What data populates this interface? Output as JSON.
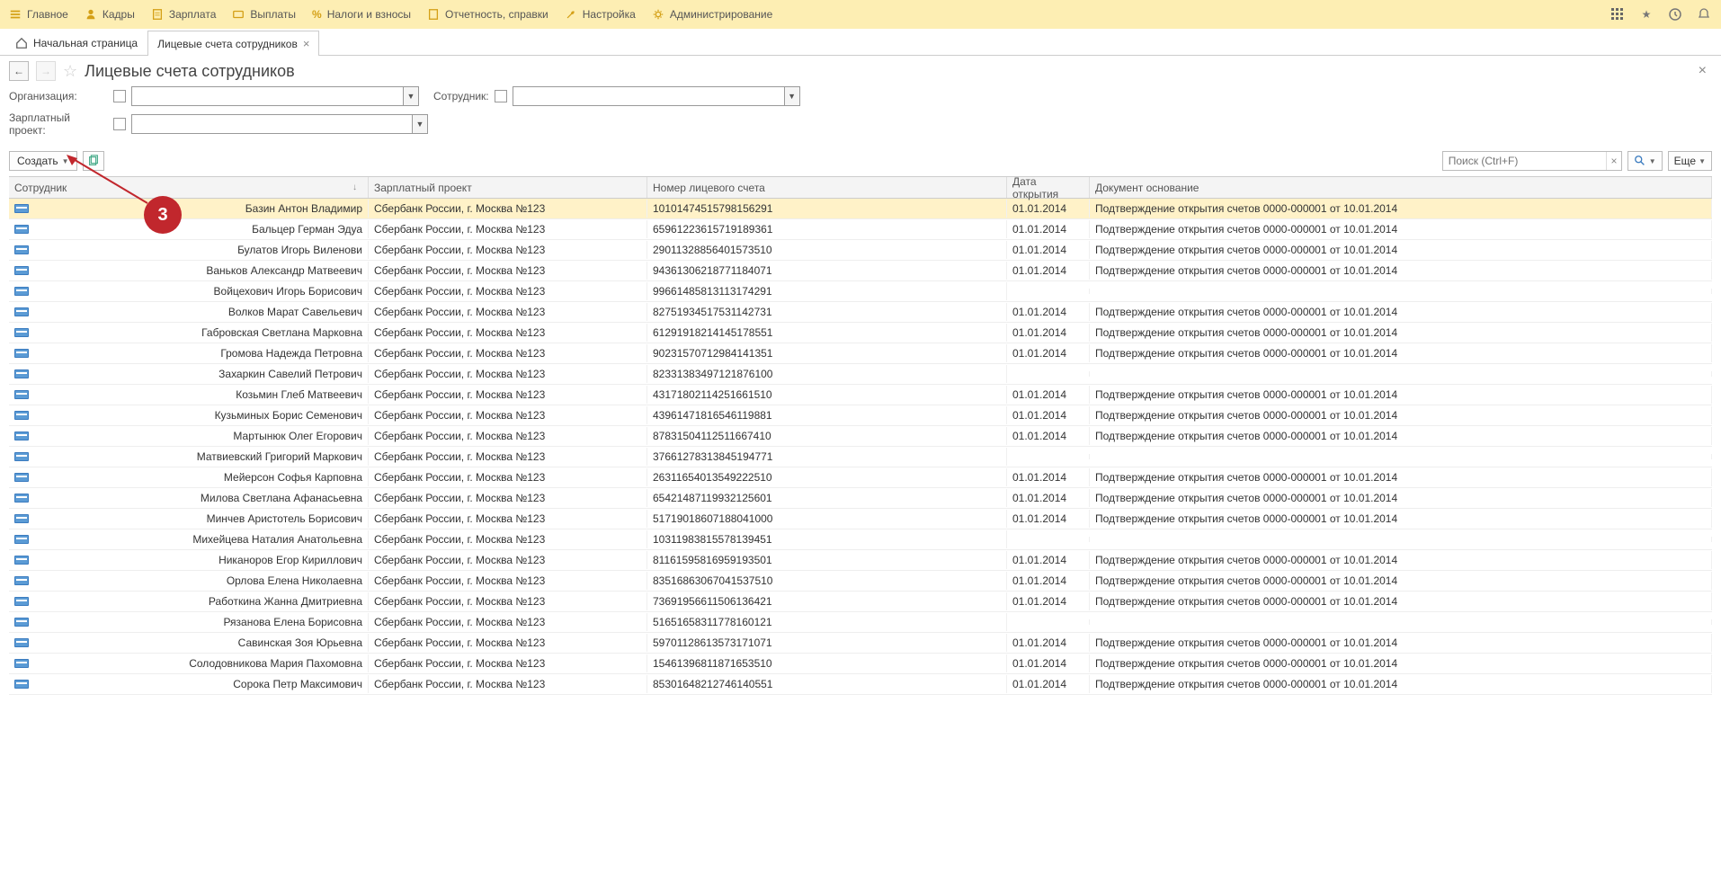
{
  "menu": {
    "items": [
      {
        "label": "Главное"
      },
      {
        "label": "Кадры"
      },
      {
        "label": "Зарплата"
      },
      {
        "label": "Выплаты"
      },
      {
        "label": "Налоги и взносы"
      },
      {
        "label": "Отчетность, справки"
      },
      {
        "label": "Настройка"
      },
      {
        "label": "Администрирование"
      }
    ]
  },
  "tabs": {
    "home": "Начальная страница",
    "active": "Лицевые счета сотрудников"
  },
  "page": {
    "title": "Лицевые счета сотрудников"
  },
  "filters": {
    "org_label": "Организация:",
    "emp_label": "Сотрудник:",
    "proj_label": "Зарплатный проект:"
  },
  "toolbar": {
    "create": "Создать",
    "search_placeholder": "Поиск (Ctrl+F)",
    "more": "Еще"
  },
  "grid": {
    "headers": {
      "emp": "Сотрудник",
      "proj": "Зарплатный проект",
      "acct": "Номер лицевого счета",
      "date": "Дата открытия",
      "doc": "Документ основание"
    },
    "rows": [
      {
        "emp": "Базин Антон Владимир",
        "proj": "Сбербанк России, г. Москва №123",
        "acct": "10101474515798156291",
        "date": "01.01.2014",
        "doc": "Подтверждение открытия счетов 0000-000001 от 10.01.2014",
        "selected": true
      },
      {
        "emp": "Бальцер Герман Эдуа",
        "proj": "Сбербанк России, г. Москва №123",
        "acct": "65961223615719189361",
        "date": "01.01.2014",
        "doc": "Подтверждение открытия счетов 0000-000001 от 10.01.2014"
      },
      {
        "emp": "Булатов Игорь Виленови",
        "proj": "Сбербанк России, г. Москва №123",
        "acct": "29011328856401573510",
        "date": "01.01.2014",
        "doc": "Подтверждение открытия счетов 0000-000001 от 10.01.2014"
      },
      {
        "emp": "Ваньков Александр Матвеевич",
        "proj": "Сбербанк России, г. Москва №123",
        "acct": "94361306218771184071",
        "date": "01.01.2014",
        "doc": "Подтверждение открытия счетов 0000-000001 от 10.01.2014"
      },
      {
        "emp": "Войцехович Игорь Борисович",
        "proj": "Сбербанк России, г. Москва №123",
        "acct": "99661485813113174291",
        "date": "",
        "doc": ""
      },
      {
        "emp": "Волков Марат Савельевич",
        "proj": "Сбербанк России, г. Москва №123",
        "acct": "82751934517531142731",
        "date": "01.01.2014",
        "doc": "Подтверждение открытия счетов 0000-000001 от 10.01.2014"
      },
      {
        "emp": "Габровская Светлана Марковна",
        "proj": "Сбербанк России, г. Москва №123",
        "acct": "61291918214145178551",
        "date": "01.01.2014",
        "doc": "Подтверждение открытия счетов 0000-000001 от 10.01.2014"
      },
      {
        "emp": "Громова Надежда Петровна",
        "proj": "Сбербанк России, г. Москва №123",
        "acct": "90231570712984141351",
        "date": "01.01.2014",
        "doc": "Подтверждение открытия счетов 0000-000001 от 10.01.2014"
      },
      {
        "emp": "Захаркин Савелий Петрович",
        "proj": "Сбербанк России, г. Москва №123",
        "acct": "82331383497121876100",
        "date": "",
        "doc": ""
      },
      {
        "emp": "Козьмин Глеб Матвеевич",
        "proj": "Сбербанк России, г. Москва №123",
        "acct": "43171802114251661510",
        "date": "01.01.2014",
        "doc": "Подтверждение открытия счетов 0000-000001 от 10.01.2014"
      },
      {
        "emp": "Кузьминых Борис Семенович",
        "proj": "Сбербанк России, г. Москва №123",
        "acct": "43961471816546119881",
        "date": "01.01.2014",
        "doc": "Подтверждение открытия счетов 0000-000001 от 10.01.2014"
      },
      {
        "emp": "Мартынюк Олег Егорович",
        "proj": "Сбербанк России, г. Москва №123",
        "acct": "87831504112511667410",
        "date": "01.01.2014",
        "doc": "Подтверждение открытия счетов 0000-000001 от 10.01.2014"
      },
      {
        "emp": "Матвиевский Григорий Маркович",
        "proj": "Сбербанк России, г. Москва №123",
        "acct": "37661278313845194771",
        "date": "",
        "doc": ""
      },
      {
        "emp": "Мейерсон Софья Карповна",
        "proj": "Сбербанк России, г. Москва №123",
        "acct": "26311654013549222510",
        "date": "01.01.2014",
        "doc": "Подтверждение открытия счетов 0000-000001 от 10.01.2014"
      },
      {
        "emp": "Милова Светлана Афанасьевна",
        "proj": "Сбербанк России, г. Москва №123",
        "acct": "65421487119932125601",
        "date": "01.01.2014",
        "doc": "Подтверждение открытия счетов 0000-000001 от 10.01.2014"
      },
      {
        "emp": "Минчев Аристотель Борисович",
        "proj": "Сбербанк России, г. Москва №123",
        "acct": "51719018607188041000",
        "date": "01.01.2014",
        "doc": "Подтверждение открытия счетов 0000-000001 от 10.01.2014"
      },
      {
        "emp": "Михейцева Наталия Анатольевна",
        "proj": "Сбербанк России, г. Москва №123",
        "acct": "10311983815578139451",
        "date": "",
        "doc": ""
      },
      {
        "emp": "Никаноров Егор Кириллович",
        "proj": "Сбербанк России, г. Москва №123",
        "acct": "81161595816959193501",
        "date": "01.01.2014",
        "doc": "Подтверждение открытия счетов 0000-000001 от 10.01.2014"
      },
      {
        "emp": "Орлова Елена Николаевна",
        "proj": "Сбербанк России, г. Москва №123",
        "acct": "83516863067041537510",
        "date": "01.01.2014",
        "doc": "Подтверждение открытия счетов 0000-000001 от 10.01.2014"
      },
      {
        "emp": "Работкина Жанна Дмитриевна",
        "proj": "Сбербанк России, г. Москва №123",
        "acct": "73691956611506136421",
        "date": "01.01.2014",
        "doc": "Подтверждение открытия счетов 0000-000001 от 10.01.2014"
      },
      {
        "emp": "Рязанова Елена Борисовна",
        "proj": "Сбербанк России, г. Москва №123",
        "acct": "51651658311778160121",
        "date": "",
        "doc": ""
      },
      {
        "emp": "Савинская Зоя Юрьевна",
        "proj": "Сбербанк России, г. Москва №123",
        "acct": "59701128613573171071",
        "date": "01.01.2014",
        "doc": "Подтверждение открытия счетов 0000-000001 от 10.01.2014"
      },
      {
        "emp": "Солодовникова Мария Пахомовна",
        "proj": "Сбербанк России, г. Москва №123",
        "acct": "15461396811871653510",
        "date": "01.01.2014",
        "doc": "Подтверждение открытия счетов 0000-000001 от 10.01.2014"
      },
      {
        "emp": "Сорока Петр Максимович",
        "proj": "Сбербанк России, г. Москва №123",
        "acct": "85301648212746140551",
        "date": "01.01.2014",
        "doc": "Подтверждение открытия счетов 0000-000001 от 10.01.2014"
      }
    ]
  },
  "annotation": {
    "badge": "3"
  }
}
